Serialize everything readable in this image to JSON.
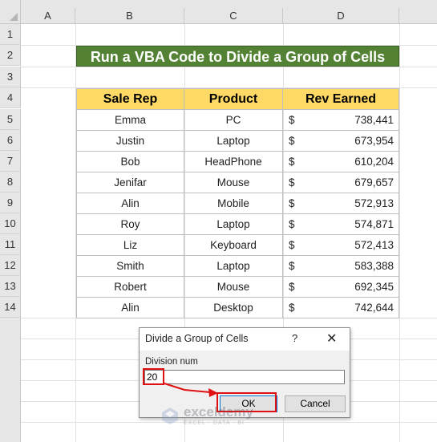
{
  "spreadsheet": {
    "columns": [
      "A",
      "B",
      "C",
      "D"
    ],
    "rows": [
      "1",
      "2",
      "3",
      "4",
      "5",
      "6",
      "7",
      "8",
      "9",
      "10",
      "11",
      "12",
      "13",
      "14"
    ],
    "title": "Run a VBA Code to Divide a Group of Cells",
    "table": {
      "headers": [
        "Sale Rep",
        "Product",
        "Rev Earned"
      ],
      "currency": "$",
      "rows": [
        {
          "rep": "Emma",
          "product": "PC",
          "rev": "738,441"
        },
        {
          "rep": "Justin",
          "product": "Laptop",
          "rev": "673,954"
        },
        {
          "rep": "Bob",
          "product": "HeadPhone",
          "rev": "610,204"
        },
        {
          "rep": "Jenifar",
          "product": "Mouse",
          "rev": "679,657"
        },
        {
          "rep": "Alin",
          "product": "Mobile",
          "rev": "572,913"
        },
        {
          "rep": "Roy",
          "product": "Laptop",
          "rev": "574,871"
        },
        {
          "rep": "Liz",
          "product": "Keyboard",
          "rev": "572,413"
        },
        {
          "rep": "Smith",
          "product": "Laptop",
          "rev": "583,388"
        },
        {
          "rep": "Robert",
          "product": "Mouse",
          "rev": "692,345"
        },
        {
          "rep": "Alin",
          "product": "Desktop",
          "rev": "742,644"
        }
      ],
      "header_color": "#ffd966",
      "title_color": "#548235"
    }
  },
  "dialog": {
    "title": "Divide a Group of Cells",
    "help": "?",
    "close": "✕",
    "label": "Division num",
    "value": "20",
    "ok": "OK",
    "cancel": "Cancel"
  },
  "highlight_color": "#e01010",
  "watermark": {
    "name": "exceldemy",
    "tagline": "EXCEL · DATA · BI"
  }
}
